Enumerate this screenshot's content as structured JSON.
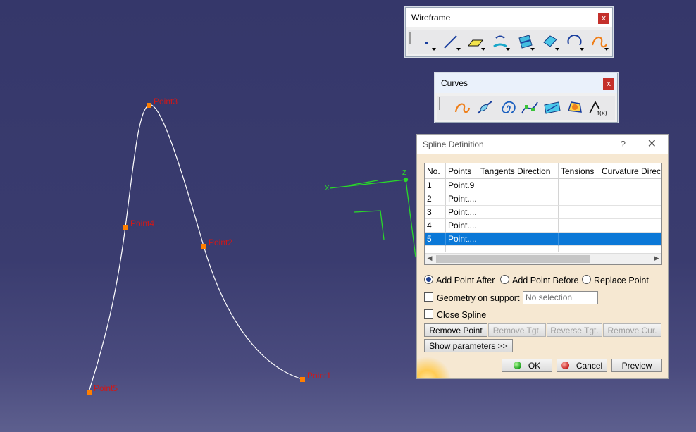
{
  "points": [
    {
      "label": "Point1"
    },
    {
      "label": "Point2"
    },
    {
      "label": "Point3"
    },
    {
      "label": "Point4"
    },
    {
      "label": "Point5"
    }
  ],
  "axis": {
    "z_label": "Z",
    "x_label": "X"
  },
  "toolbars": {
    "wireframe": {
      "title": "Wireframe",
      "close": "x",
      "buttons": [
        "point-icon",
        "line-icon",
        "plane-icon",
        "projection-icon",
        "intersection-icon",
        "offset-surface-icon",
        "circle-icon",
        "spline-icon"
      ]
    },
    "curves": {
      "title": "Curves",
      "close": "x",
      "buttons": [
        "spline-icon",
        "helix-connect-icon",
        "spiral-icon",
        "spine-icon",
        "isoparametric-curve-icon",
        "polyline-icon",
        "law-curve-icon"
      ]
    }
  },
  "dialog": {
    "title": "Spline Definition",
    "help": "?",
    "close": "✕",
    "columns": [
      "No.",
      "Points",
      "Tangents Direction",
      "Tensions",
      "Curvature Direc"
    ],
    "rows": [
      {
        "no": "1",
        "point": "Point.9"
      },
      {
        "no": "2",
        "point": "Point...."
      },
      {
        "no": "3",
        "point": "Point...."
      },
      {
        "no": "4",
        "point": "Point...."
      },
      {
        "no": "5",
        "point": "Point...."
      }
    ],
    "selected_row": "5",
    "radio_options": [
      "Add Point After",
      "Add Point Before",
      "Replace Point"
    ],
    "radio_selected": "Add Point After",
    "geometry_on_support": "Geometry on support",
    "support_value": "No selection",
    "close_spline": "Close Spline",
    "remove_point": "Remove Point",
    "remove_tgt": "Remove Tgt.",
    "reverse_tgt": "Reverse Tgt.",
    "remove_cur": "Remove Cur.",
    "show_parameters": "Show parameters >>",
    "ok": "OK",
    "cancel": "Cancel",
    "preview": "Preview"
  }
}
